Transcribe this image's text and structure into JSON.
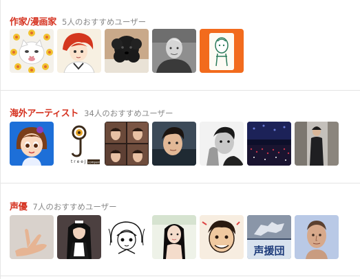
{
  "sections": [
    {
      "title": "作家/漫画家",
      "count": "5人のおすすめユーザー"
    },
    {
      "title": "海外アーティスト",
      "count": "34人のおすすめユーザー"
    },
    {
      "title": "声優",
      "count": "7人のおすすめユーザー"
    }
  ],
  "avatar_badges": {
    "treej_logo": "t r e e J",
    "treej_sub": "company",
    "seien": "声援団"
  },
  "colors": {
    "title": "#d5311f",
    "count": "#888888",
    "divider": "#e3e3e3"
  }
}
